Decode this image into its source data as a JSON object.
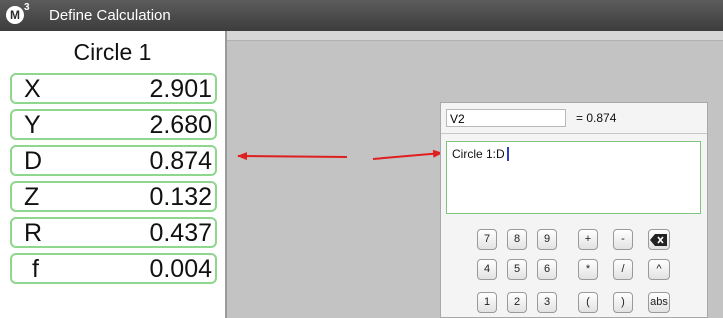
{
  "window": {
    "icon_letter": "M",
    "icon_superscript": "3",
    "title": "Define Calculation"
  },
  "feature_panel": {
    "title": "Circle 1",
    "rows": [
      {
        "label": "X",
        "value": "2.901"
      },
      {
        "label": "Y",
        "value": "2.680"
      },
      {
        "label": "D",
        "value": "0.874"
      },
      {
        "label": "Z",
        "value": "0.132"
      },
      {
        "label": "R",
        "value": "0.437"
      },
      {
        "label": "f",
        "value": "0.004"
      }
    ]
  },
  "calc_dialog": {
    "name_value": "V2",
    "result_text": "= 0.874",
    "formula": "Circle 1:D",
    "keypad": [
      [
        "7",
        "8",
        "9",
        "+",
        "-",
        "backspace"
      ],
      [
        "4",
        "5",
        "6",
        "*",
        "/",
        "^"
      ],
      [
        "1",
        "2",
        "3",
        "(",
        ")",
        "abs"
      ]
    ]
  },
  "colors": {
    "row_border": "#8fd68f",
    "arrow": "#e02020",
    "caret": "#2b3fbf",
    "titlebar": "#4a4a4a",
    "workspace": "#c3c3c3"
  }
}
